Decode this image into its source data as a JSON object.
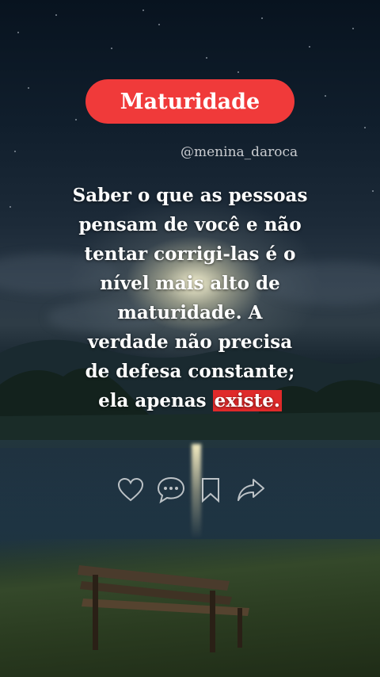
{
  "post": {
    "title": "Maturidade",
    "author": "@menina_daroca",
    "quote_lines": [
      "Saber o que as pessoas",
      "pensam de você e não",
      "tentar corrigi-las é o",
      "nível mais alto de",
      "maturidade. A",
      "verdade não precisa",
      "de defesa constante;",
      "ela apenas"
    ],
    "highlight_word": "existe."
  },
  "actions": {
    "icons": [
      "heart-icon",
      "comment-icon",
      "bookmark-icon",
      "share-icon"
    ]
  },
  "colors": {
    "title_pill": "#f03a3a",
    "highlight": "#e02a2a",
    "text": "#ffffff",
    "handle_text": "#c9ccd0"
  }
}
